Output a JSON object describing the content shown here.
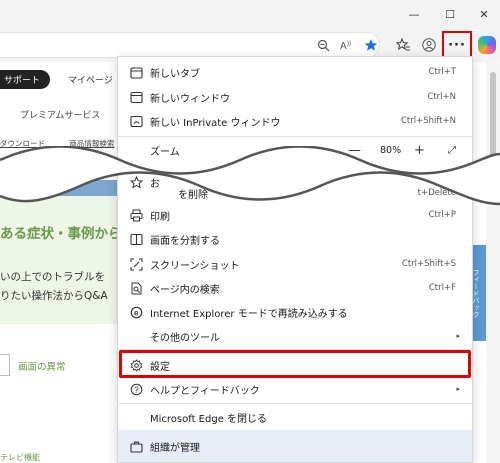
{
  "window": {
    "minimize_symbol": "—",
    "maximize_symbol": "☐",
    "close_symbol": "✕"
  },
  "toolbar": {
    "icons": [
      "zoom-icon",
      "read-aloud-icon",
      "favorite-star-icon",
      "favorites-list-icon",
      "profile-icon"
    ],
    "more_label": "···",
    "accent_color": "#e00000"
  },
  "page": {
    "support_label": "サポート",
    "mypage_label": "マイページ",
    "premium_label": "プレミアムサービス",
    "links": [
      "ダウンロード",
      "商品情報検索"
    ],
    "heading": "ある症状・事例から",
    "line1": "いの上でのトラブルを",
    "line2": "りたい操作法からQ&A",
    "feedback_label": "フィードバック",
    "screen_abnormal": "画面の異常",
    "bottom_label": "テレビ機能"
  },
  "menu": {
    "items": [
      {
        "label": "新しいタブ",
        "shortcut": "Ctrl+T",
        "icon": "new-tab-icon"
      },
      {
        "label": "新しいウィンドウ",
        "shortcut": "Ctrl+N",
        "icon": "new-window-icon"
      },
      {
        "label": "新しい InPrivate ウィンドウ",
        "shortcut": "Ctrl+Shift+N",
        "icon": "inprivate-icon"
      },
      {
        "label": "ズーム",
        "shortcut": "",
        "icon": ""
      },
      {
        "label": "お",
        "shortcut": "",
        "icon": "favorites-icon"
      },
      {
        "label": "を削除",
        "shortcut": "t+Delete",
        "icon": ""
      },
      {
        "label": "印刷",
        "shortcut": "Ctrl+P",
        "icon": "print-icon"
      },
      {
        "label": "画面を分割する",
        "shortcut": "",
        "icon": "split-screen-icon"
      },
      {
        "label": "スクリーンショット",
        "shortcut": "Ctrl+Shift+S",
        "icon": "screenshot-icon"
      },
      {
        "label": "ページ内の検索",
        "shortcut": "Ctrl+F",
        "icon": "find-icon"
      },
      {
        "label": "Internet Explorer モードで再読み込みする",
        "shortcut": "",
        "icon": "ie-mode-icon"
      },
      {
        "label": "その他のツール",
        "shortcut": "",
        "icon": ""
      },
      {
        "label": "設定",
        "shortcut": "",
        "icon": "settings-icon"
      },
      {
        "label": "ヘルプとフィードバック",
        "shortcut": "",
        "icon": "help-icon"
      },
      {
        "label": "Microsoft Edge を閉じる",
        "shortcut": "",
        "icon": ""
      },
      {
        "label": "組織が管理",
        "shortcut": "",
        "icon": "managed-icon"
      }
    ],
    "zoom": {
      "minus": "—",
      "value": "80%",
      "plus": "+",
      "fullscreen": "⤢"
    },
    "submenu_arrow": "▸"
  }
}
